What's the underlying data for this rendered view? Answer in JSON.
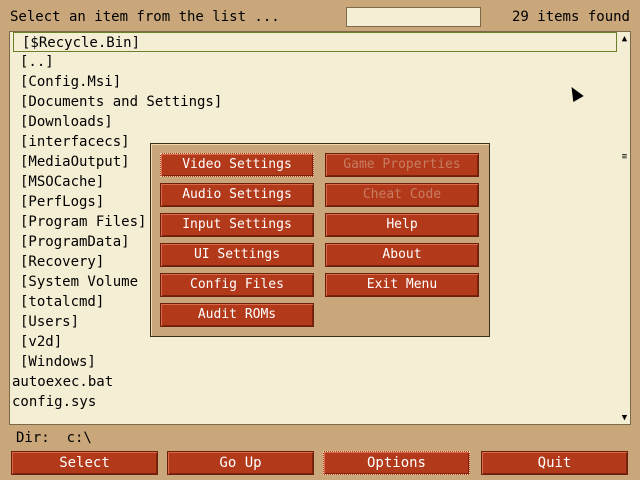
{
  "header": {
    "prompt": "Select an item from the list ...",
    "search_value": "",
    "item_count": "29 items found"
  },
  "list": {
    "items": [
      "[$Recycle.Bin]",
      "[..]",
      "[Config.Msi]",
      "[Documents and Settings]",
      "[Downloads]",
      "[interfacecs]",
      "[MediaOutput]",
      "[MSOCache]",
      "[PerfLogs]",
      "[Program Files]",
      "[ProgramData]",
      "[Recovery]",
      "[System Volume",
      "[totalcmd]",
      "[Users]",
      "[v2d]",
      "[Windows]",
      "autoexec.bat",
      "config.sys"
    ],
    "selected_index": 0
  },
  "menu": {
    "left": [
      "Video Settings",
      "Audio Settings",
      "Input Settings",
      "UI Settings",
      "Config Files",
      "Audit ROMs"
    ],
    "right": [
      "Game Properties",
      "Cheat Code",
      "Help",
      "About",
      "Exit Menu"
    ],
    "disabled": [
      "Game Properties",
      "Cheat Code"
    ],
    "focused": "Video Settings"
  },
  "dir": {
    "label": "Dir:",
    "path": "c:\\"
  },
  "buttons": {
    "select": "Select",
    "go_up": "Go Up",
    "options": "Options",
    "quit": "Quit"
  },
  "colors": {
    "background": "#c9a77a",
    "list_bg": "#f4eed4",
    "button_bg": "#b23a1a",
    "button_text": "#ffffff",
    "selection_border": "#6b7e28"
  }
}
